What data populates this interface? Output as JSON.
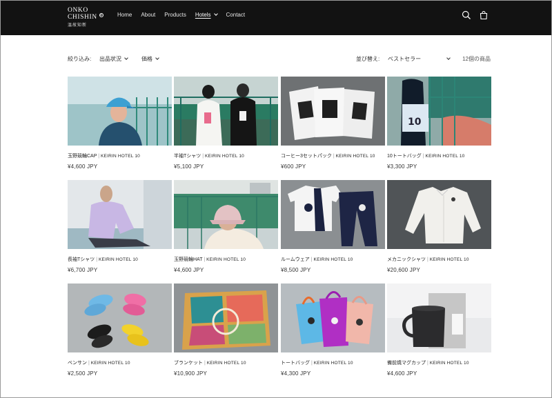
{
  "header": {
    "logo_line1": "ONKO",
    "logo_line2": "CHISHIN",
    "logo_sub": "温故知新",
    "nav": [
      {
        "label": "Home"
      },
      {
        "label": "About"
      },
      {
        "label": "Products"
      },
      {
        "label": "Hotels"
      },
      {
        "label": "Contact"
      }
    ],
    "icons": [
      "search-icon",
      "cart-icon"
    ],
    "active_nav": "Hotels"
  },
  "filters": {
    "label": "絞り込み:",
    "availability": "出品状況",
    "price": "価格",
    "sort_label": "並び替え:",
    "sort_value": "ベストセラー",
    "count": "12個の商品"
  },
  "products": [
    {
      "name": "玉野競輪CAP",
      "brand": "KEIRIN HOTEL 10",
      "price": "¥4,600 JPY"
    },
    {
      "name": "半袖Tシャツ",
      "brand": "KEIRIN HOTEL 10",
      "price": "¥5,100 JPY"
    },
    {
      "name": "コーヒー3セットパック",
      "brand": "KEIRIN HOTEL 10",
      "price": "¥600 JPY"
    },
    {
      "name": "10トートバッグ",
      "brand": "KEIRIN HOTEL 10",
      "price": "¥3,300 JPY"
    },
    {
      "name": "長袖Tシャツ",
      "brand": "KEIRIN HOTEL 10",
      "price": "¥6,700 JPY"
    },
    {
      "name": "玉野競輪HAT",
      "brand": "KEIRIN HOTEL 10",
      "price": "¥4,600 JPY"
    },
    {
      "name": "ルームウェア",
      "brand": "KEIRIN HOTEL 10",
      "price": "¥8,500 JPY"
    },
    {
      "name": "メカニックシャツ",
      "brand": "KEIRIN HOTEL 10",
      "price": "¥20,600 JPY"
    },
    {
      "name": "ベンサン",
      "brand": "KEIRIN HOTEL 10",
      "price": "¥2,500 JPY"
    },
    {
      "name": "ブランケット",
      "brand": "KEIRIN HOTEL 10",
      "price": "¥10,900 JPY"
    },
    {
      "name": "トートバッグ",
      "brand": "KEIRIN HOTEL 10",
      "price": "¥4,300 JPY"
    },
    {
      "name": "備前焼マグカップ",
      "brand": "KEIRIN HOTEL 10",
      "price": "¥4,600 JPY"
    }
  ],
  "separator": "|",
  "colors": {
    "header_bg": "#121212",
    "page_bg": "#ffffff",
    "accent_teal": "#2f8a7a"
  }
}
